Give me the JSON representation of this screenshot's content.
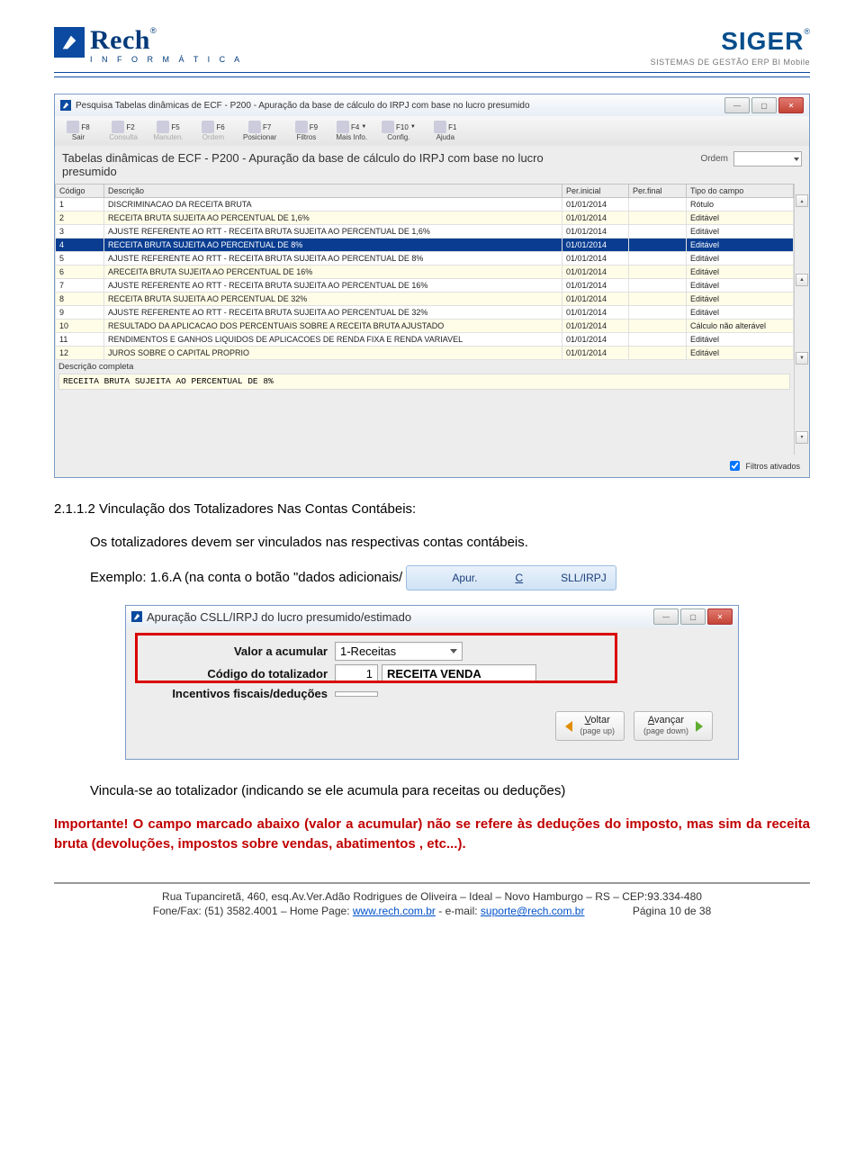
{
  "header": {
    "rech_name": "Rech",
    "rech_sub": "I N F O R M Á T I C A",
    "siger_name": "SIGER",
    "siger_sub": "SISTEMAS DE GESTÃO  ERP  BI  Mobile"
  },
  "win1": {
    "title": "Pesquisa Tabelas dinâmicas de ECF - P200 - Apuração da base de cálculo do IRPJ com base no lucro presumido",
    "toolbar": [
      {
        "key": "F8",
        "label": "Sair"
      },
      {
        "key": "F2",
        "label": "Consulta"
      },
      {
        "key": "F5",
        "label": "Manuten."
      },
      {
        "key": "F6",
        "label": "Ordem"
      },
      {
        "key": "F7",
        "label": "Posicionar"
      },
      {
        "key": "F9",
        "label": "Filtros"
      },
      {
        "key": "F4",
        "label": "Mais Info."
      },
      {
        "key": "F10",
        "label": "Config."
      },
      {
        "key": "F1",
        "label": "Ajuda"
      }
    ],
    "subtitle": "Tabelas dinâmicas de ECF - P200 - Apuração da base de cálculo do IRPJ com base no lucro presumido",
    "ordem_label": "Ordem",
    "columns": [
      "Código",
      "Descrição",
      "Per.inicial",
      "Per.final",
      "Tipo do campo"
    ],
    "rows": [
      {
        "c": "1",
        "d": "DISCRIMINACAO DA RECEITA BRUTA",
        "pi": "01/01/2014",
        "pf": "",
        "t": "Rótulo"
      },
      {
        "c": "2",
        "d": "RECEITA BRUTA SUJEITA AO PERCENTUAL DE 1,6%",
        "pi": "01/01/2014",
        "pf": "",
        "t": "Editável"
      },
      {
        "c": "3",
        "d": "AJUSTE REFERENTE AO RTT - RECEITA BRUTA SUJEITA AO PERCENTUAL DE 1,6%",
        "pi": "01/01/2014",
        "pf": "",
        "t": "Editável"
      },
      {
        "c": "4",
        "d": "RECEITA BRUTA SUJEITA AO PERCENTUAL DE 8%",
        "pi": "01/01/2014",
        "pf": "",
        "t": "Editável",
        "sel": true
      },
      {
        "c": "5",
        "d": "AJUSTE REFERENTE AO RTT - RECEITA BRUTA SUJEITA AO PERCENTUAL DE 8%",
        "pi": "01/01/2014",
        "pf": "",
        "t": "Editável"
      },
      {
        "c": "6",
        "d": "ARECEITA BRUTA SUJEITA AO PERCENTUAL DE 16%",
        "pi": "01/01/2014",
        "pf": "",
        "t": "Editável"
      },
      {
        "c": "7",
        "d": "AJUSTE REFERENTE AO RTT - RECEITA BRUTA SUJEITA AO PERCENTUAL DE 16%",
        "pi": "01/01/2014",
        "pf": "",
        "t": "Editável"
      },
      {
        "c": "8",
        "d": "RECEITA BRUTA SUJEITA AO PERCENTUAL DE 32%",
        "pi": "01/01/2014",
        "pf": "",
        "t": "Editável"
      },
      {
        "c": "9",
        "d": "AJUSTE REFERENTE AO RTT - RECEITA BRUTA SUJEITA AO PERCENTUAL DE 32%",
        "pi": "01/01/2014",
        "pf": "",
        "t": "Editável"
      },
      {
        "c": "10",
        "d": "RESULTADO DA APLICACAO DOS PERCENTUAIS SOBRE A RECEITA BRUTA AJUSTADO",
        "pi": "01/01/2014",
        "pf": "",
        "t": "Cálculo não alterável"
      },
      {
        "c": "11",
        "d": "RENDIMENTOS E GANHOS LIQUIDOS DE APLICACOES DE RENDA FIXA E RENDA VARIAVEL",
        "pi": "01/01/2014",
        "pf": "",
        "t": "Editável"
      },
      {
        "c": "12",
        "d": "JUROS SOBRE O CAPITAL PROPRIO",
        "pi": "01/01/2014",
        "pf": "",
        "t": "Editável"
      }
    ],
    "desc_label": "Descrição completa",
    "desc_value": "RECEITA BRUTA SUJEITA AO PERCENTUAL DE 8%",
    "filters_label": "Filtros ativados"
  },
  "body": {
    "h": "2.1.1.2  Vinculação dos Totalizadores Nas Contas Contábeis:",
    "p1a": "Os totalizadores devem ser vinculados nas respectivas contas contábeis.",
    "p2a": "Exemplo: 1.6.A (na conta o botão \"dados adicionais/",
    "apur_pre": "Apur.",
    "apur_und": "C",
    "apur_post": "SLL/IRPJ",
    "p3": "Vincula-se ao totalizador (indicando se ele acumula para receitas ou deduções)",
    "imp_lead": "Importante!",
    "imp_rest": " O campo marcado abaixo (valor a acumular) não se refere às deduções do imposto, mas sim da receita bruta (devoluções, impostos sobre vendas, abatimentos , etc...)."
  },
  "win2": {
    "title": "Apuração CSLL/IRPJ do lucro presumido/estimado",
    "rows": {
      "valor_lbl": "Valor a acumular",
      "valor_sel": "1-Receitas",
      "cod_lbl": "Código do totalizador",
      "cod_num": "1",
      "cod_name": "RECEITA VENDA",
      "inc_lbl": "Incentivos fiscais/deduções"
    },
    "back_t": "Voltar",
    "back_u": "V",
    "back_s": "(page up)",
    "fwd_t": "Avançar",
    "fwd_u": "A",
    "fwd_s": "(page down)"
  },
  "footer": {
    "l1": "Rua Tupanciretã, 460, esq.Av.Ver.Adão Rodrigues de Oliveira – Ideal  –  Novo Hamburgo  –  RS  –  CEP:93.334-480",
    "l2a": "Fone/Fax: (51) 3582.4001 – Home Page: ",
    "l2link1": "www.rech.com.br",
    "l2b": " - e-mail: ",
    "l2link2": "suporte@rech.com.br",
    "l2c": "                Página 10 de 38"
  }
}
